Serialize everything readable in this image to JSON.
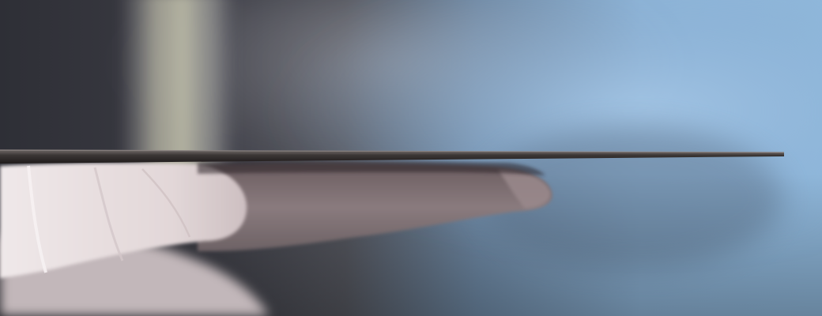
{
  "image": {
    "subject": "gloved-hand-holding-thin-sheet",
    "colors": {
      "background_left": "#2f2f37",
      "background_right": "#8fb6d8",
      "glove_light": "#e9dfe0",
      "glove_mid": "#b8a7ab",
      "sheet": "#3b3736",
      "sheet_edge": "#8a8280"
    }
  }
}
